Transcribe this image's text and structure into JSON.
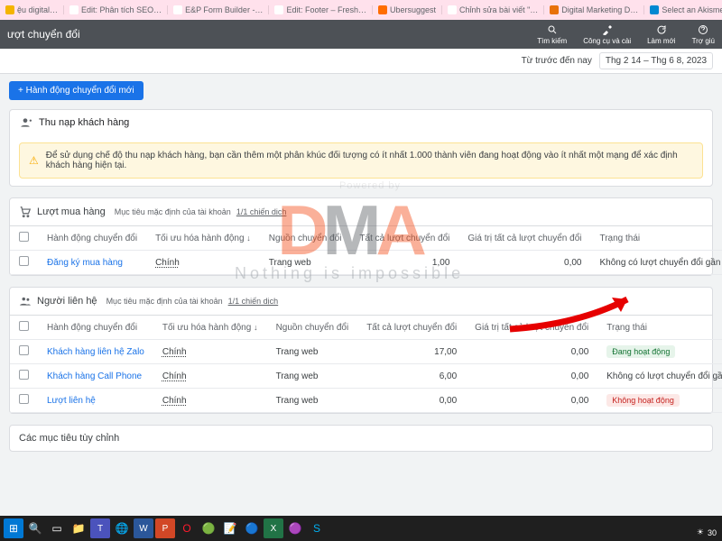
{
  "tabs": [
    "ệu digital…",
    "Edit: Phân tích SEO…",
    "E&P Form Builder -…",
    "Edit: Footer – Fresh…",
    "Ubersuggest",
    "Chỉnh sửa bài viết \"…",
    "Digital Marketing D…",
    "Select an Akismet S…"
  ],
  "header": {
    "title": "ượt chuyển đổi",
    "search": "Tìm kiếm",
    "tools": "Công cụ và cài",
    "refresh": "Làm mới",
    "help": "Trợ giú"
  },
  "datebar": {
    "prefix": "Từ trước đến nay",
    "range": "Thg 2 14 – Thg 6 8, 2023"
  },
  "newAction": "+ Hành động chuyển đổi mới",
  "acquisition": {
    "title": "Thu nạp khách hàng",
    "alert": "Để sử dụng chế độ thu nạp khách hàng, bạn cần thêm một phân khúc đối tượng có ít nhất 1.000 thành viên đang hoạt động vào ít nhất một mạng để xác định khách hàng hiện tại."
  },
  "cols": {
    "action": "Hành động chuyển đổi",
    "opt": "Tối ưu hóa hành động",
    "src": "Nguồn chuyển đổi",
    "all": "Tất cả lượt chuyển đổi",
    "val": "Giá trị tất cả lượt chuyển đổi",
    "status": "Trạng thái"
  },
  "purchases": {
    "title": "Lượt mua hàng",
    "meta1": "Mục tiêu mặc định của tài khoản",
    "meta2": "1/1 chiến dịch",
    "rows": [
      {
        "name": "Đăng ký mua hàng",
        "opt": "Chính",
        "src": "Trang web",
        "all": "1,00",
        "val": "0,00",
        "status": "Không có lượt chuyển đổi gần đây"
      }
    ]
  },
  "contacts": {
    "title": "Người liên hệ",
    "meta1": "Mục tiêu mặc định của tài khoản",
    "meta2": "1/1 chiến dịch",
    "rows": [
      {
        "name": "Khách hàng liên hệ Zalo",
        "opt": "Chính",
        "src": "Trang web",
        "all": "17,00",
        "val": "0,00",
        "status": "Đang hoạt động",
        "badge": "g"
      },
      {
        "name": "Khách hàng Call Phone",
        "opt": "Chính",
        "src": "Trang web",
        "all": "6,00",
        "val": "0,00",
        "status": "Không có lượt chuyển đổi gần đây"
      },
      {
        "name": "Lượt liên hệ",
        "opt": "Chính",
        "src": "Trang web",
        "all": "0,00",
        "val": "0,00",
        "status": "Không hoạt động",
        "badge": "r"
      }
    ]
  },
  "custom": "Các mục tiêu tùy chỉnh",
  "watermark": {
    "d": "D",
    "m": "M",
    "a": "A",
    "sub": "Nothing is impossible"
  },
  "powered": "Powered by",
  "tray": {
    "temp": "30"
  }
}
